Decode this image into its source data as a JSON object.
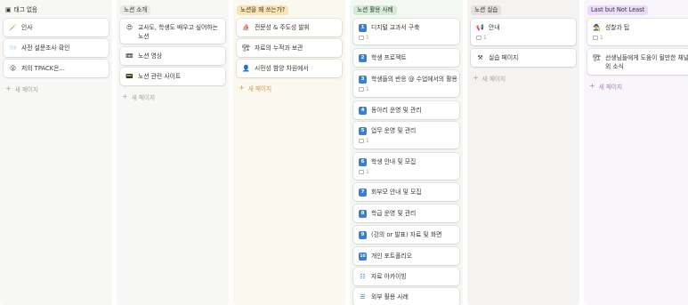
{
  "columns": [
    {
      "key": "no-tag",
      "label": "태그 없음",
      "icon": "board-icon",
      "icon_glyph": "▣",
      "bg": "#f7f7f5",
      "tag_bg": "transparent",
      "tag_color": "#37352f",
      "cards": [
        {
          "emoji": "🪄",
          "title": "인사",
          "comments": ""
        },
        {
          "emoji": "📨",
          "title": "사전 설문조사 확인",
          "comments": ""
        },
        {
          "emoji": "😮",
          "title": "저의 TPACK은...",
          "comments": ""
        }
      ],
      "add_label": "새 페이지"
    },
    {
      "key": "notion-intro",
      "label": "노션 소개",
      "icon": "",
      "icon_glyph": "",
      "bg": "#f7f7f5",
      "tag_bg": "#e9e9e7",
      "tag_color": "#37352f",
      "cards": [
        {
          "emoji": "😍",
          "title": "교사도, 학생도 배우고 싶어하는 노션",
          "comments": ""
        },
        {
          "emoji": "📼",
          "title": "노션 영상",
          "comments": ""
        },
        {
          "emoji": "📟",
          "title": "노션 관련 사이트",
          "comments": ""
        }
      ],
      "add_label": "새 페이지"
    },
    {
      "key": "when-to-use",
      "label": "노션을 왜 쓰는가?",
      "icon": "",
      "icon_glyph": "",
      "bg": "#fbf8ef",
      "tag_bg": "#fbe4b9",
      "tag_color": "#49290e",
      "cards": [
        {
          "emoji": "⛵",
          "title": "전문성 & 주도성 발휘",
          "comments": ""
        },
        {
          "emoji": "🏗",
          "title": "자료의 누적과 보관",
          "comments": ""
        },
        {
          "emoji": "👤",
          "title": "시민성 함양 차원에서",
          "comments": ""
        }
      ],
      "add_label": "새 페이지"
    },
    {
      "key": "use-cases",
      "label": "노션 활용 사례",
      "icon": "",
      "icon_glyph": "",
      "bg": "#f4f8f3",
      "tag_bg": "#d6ead6",
      "tag_color": "#1c3829",
      "cards": [
        {
          "emoji": "1",
          "title": "디지털 교과서 구축",
          "comments": "1"
        },
        {
          "emoji": "2",
          "title": "학생 프로젝트",
          "comments": ""
        },
        {
          "emoji": "3",
          "title": "학생들의 반응 @ 수업에서의 활용",
          "comments": "1"
        },
        {
          "emoji": "4",
          "title": "동아리 운영 및 관리",
          "comments": ""
        },
        {
          "emoji": "5",
          "title": "업무 운영 및 관리",
          "comments": "1"
        },
        {
          "emoji": "6",
          "title": "학생 안내 및 모집",
          "comments": "1"
        },
        {
          "emoji": "7",
          "title": "회부모 안내 및 모집",
          "comments": ""
        },
        {
          "emoji": "8",
          "title": "학급 운영 및 관리",
          "comments": ""
        },
        {
          "emoji": "9",
          "title": "(강의 or 발표) 자료 및 화면",
          "comments": ""
        },
        {
          "emoji": "10",
          "title": "개인 포트폴리오",
          "comments": ""
        },
        {
          "emoji": "☷",
          "title": "자료 아카이빙",
          "comments": ""
        },
        {
          "emoji": "☰",
          "title": "외부 활용 사례",
          "comments": ""
        }
      ],
      "add_label": "새 페이지"
    },
    {
      "key": "practice",
      "label": "노션 실습",
      "icon": "",
      "icon_glyph": "",
      "bg": "#f4f3f1",
      "tag_bg": "#e3e2e0",
      "tag_color": "#32302c",
      "cards": [
        {
          "emoji": "📢",
          "title": "안내",
          "comments": "1"
        },
        {
          "emoji": "⚒",
          "title": "실습 페이지",
          "comments": ""
        }
      ],
      "add_label": "새 페이지"
    },
    {
      "key": "last-but-not-least",
      "label": "Last but Not Least",
      "icon": "",
      "icon_glyph": "",
      "bg": "#f9f6fb",
      "tag_bg": "#eadcf5",
      "tag_color": "#412454",
      "cards": [
        {
          "emoji": "🧙",
          "title": "성찰과 팁",
          "comments": "1"
        },
        {
          "emoji": "🏗",
          "title": "선생님들에게 도움이 될만한 채널 외 소식",
          "comments": ""
        }
      ],
      "add_label": "새 페이지"
    }
  ]
}
